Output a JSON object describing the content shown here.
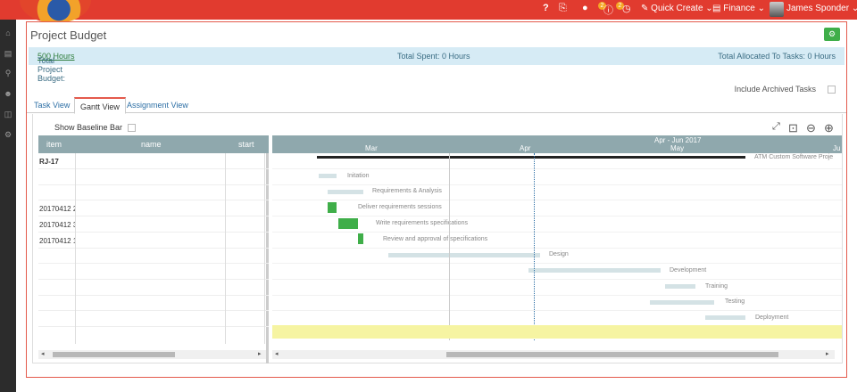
{
  "topbar": {
    "help_icon": "?",
    "quick_create": "Quick Create",
    "finance": "Finance",
    "user": "James Sponder",
    "badge_1": "2",
    "badge_2": "2"
  },
  "page": {
    "title": "Project Budget",
    "total_budget_label": "Total Project Budget:",
    "total_budget_value": "500 Hours",
    "total_spent": "Total Spent: 0 Hours",
    "total_allocated": "Total Allocated To Tasks: 0 Hours",
    "include_archived": "Include Archived Tasks"
  },
  "tabs": [
    "Task View",
    "Gantt View",
    "Assignment View"
  ],
  "gantt": {
    "show_baseline": "Show Baseline Bar",
    "columns": [
      "item",
      "name",
      "start"
    ],
    "timeline_top": "Apr - Jun 2017",
    "months": [
      "Mar",
      "Apr",
      "May",
      "Ju"
    ],
    "rows": [
      {
        "item": "RJ-17",
        "name": "ATM Custom Software Project",
        "start": "06/03/2017",
        "end": "29/0",
        "expand": "−",
        "bold": true,
        "label": "ATM Custom Software Proje"
      },
      {
        "item": "",
        "name": "Initation",
        "start": "06/03/2017",
        "end": "09/0",
        "expand": "+",
        "label": "Initation"
      },
      {
        "item": "",
        "name": "Requirements & Analysis",
        "start": "08/03/2017",
        "end": "14/0",
        "expand": "−",
        "label": "Requirements & Analysis"
      },
      {
        "item": "20170412 2",
        "name": "Deliver requirements sessions",
        "start": "08/03/2017",
        "end": "09/0",
        "expand": "",
        "label": "Deliver requirements sessions"
      },
      {
        "item": "20170412 3",
        "name": "Write requirements specifications",
        "start": "10/03/2017",
        "end": "13/0",
        "expand": "",
        "label": "Write requirements specifications"
      },
      {
        "item": "20170412 1",
        "name": "Review and approval of specifications",
        "start": "14/03/2017",
        "end": "14/0",
        "expand": "",
        "label": "Review and approval of specifications"
      },
      {
        "item": "",
        "name": "Design",
        "start": "20/03/2017",
        "end": "18/0",
        "expand": "+",
        "label": "Design"
      },
      {
        "item": "",
        "name": "Development",
        "start": "17/04/2017",
        "end": "12/0",
        "expand": "+",
        "label": "Development"
      },
      {
        "item": "",
        "name": "Training",
        "start": "14/05/2017",
        "end": "19/0",
        "expand": "+",
        "label": "Training"
      },
      {
        "item": "",
        "name": "Testing",
        "start": "11/05/2017",
        "end": "23/0",
        "expand": "+",
        "label": "Testing"
      },
      {
        "item": "",
        "name": "Deployment",
        "start": "22/05/2017",
        "end": "29/0",
        "expand": "+",
        "label": "Deployment"
      }
    ]
  },
  "colors": {
    "accent": "#e13b2f",
    "success": "#3fae49",
    "header": "#8fa8ad"
  }
}
